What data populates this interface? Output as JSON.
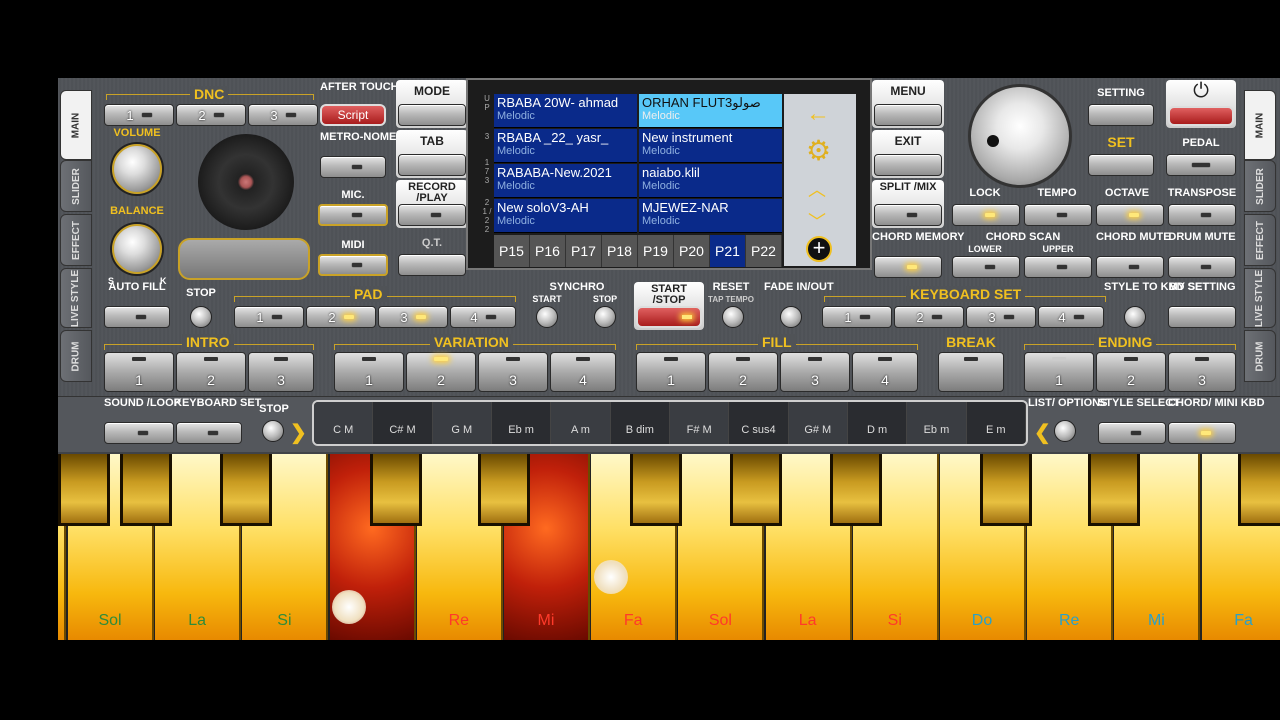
{
  "side_tabs_left": [
    "MAIN",
    "SLIDER",
    "EFFECT",
    "LIVE STYLE",
    "DRUM"
  ],
  "side_tabs_right": [
    "MAIN",
    "SLIDER",
    "EFFECT",
    "LIVE STYLE",
    "DRUM"
  ],
  "dnc": {
    "title": "DNC",
    "buttons": [
      "1",
      "2",
      "3"
    ]
  },
  "after_touch": {
    "label": "AFTER TOUCH",
    "button": "Script"
  },
  "volume": "VOLUME",
  "balance": "BALANCE",
  "balance_s": "S",
  "balance_k": "K",
  "metronome": "METRO-NOME",
  "mic": "MIC.",
  "midi": "MIDI",
  "left_col": {
    "mode": "MODE",
    "tab": "TAB",
    "record": "RECORD /PLAY",
    "qt": "Q.T."
  },
  "right_col": {
    "menu": "MENU",
    "exit": "EXIT",
    "split": "SPLIT /MIX",
    "chord_memory": "CHORD MEMORY"
  },
  "display": {
    "side_markers": [
      "U P",
      "3",
      "1 7 3",
      "2 1 / 2 2"
    ],
    "cells": [
      {
        "name": "RBABA 20W- ahmad",
        "type": "Melodic"
      },
      {
        "name": "ORHAN FLUT3صولو",
        "type": "Melodic"
      },
      {
        "name": "RBABA _22_ yasr_",
        "type": "Melodic"
      },
      {
        "name": "New instrument",
        "type": "Melodic"
      },
      {
        "name": "RABABA-New.2021",
        "type": "Melodic"
      },
      {
        "name": "naiabo.klil",
        "type": "Melodic"
      },
      {
        "name": "New soloV3-AH",
        "type": "Melodic"
      },
      {
        "name": "MJEWEZ-NAR",
        "type": "Melodic"
      }
    ],
    "pages": [
      "P15",
      "P16",
      "P17",
      "P18",
      "P19",
      "P20",
      "P21",
      "P22"
    ],
    "active_page": "P21"
  },
  "setting": "SETTING",
  "set": "SET",
  "pedal": "PEDAL",
  "lock": "LOCK",
  "tempo": "TEMPO",
  "octave": "OCTAVE",
  "transpose": "TRANSPOSE",
  "chord_scan": "CHORD SCAN",
  "chord_scan_lower": "LOWER",
  "chord_scan_upper": "UPPER",
  "chord_mute": "CHORD MUTE",
  "drum_mute": "DRUM MUTE",
  "auto_fill": "AUTO FILL",
  "stop": "STOP",
  "pad": {
    "title": "PAD",
    "buttons": [
      "1",
      "2",
      "3",
      "4"
    ]
  },
  "synchro": {
    "title": "SYNCHRO",
    "start": "START",
    "stop": "STOP"
  },
  "start_stop": "START /STOP",
  "reset": "RESET",
  "tap_tempo": "TAP TEMPO",
  "fade": "FADE IN/OUT",
  "keyboard_set": {
    "title": "KEYBOARD SET",
    "buttons": [
      "1",
      "2",
      "3",
      "4"
    ]
  },
  "style_to_kbd": "STYLE TO KBD SET",
  "my_setting": "MY SETTING",
  "intro": {
    "title": "INTRO",
    "buttons": [
      "1",
      "2",
      "3"
    ]
  },
  "variation": {
    "title": "VARIATION",
    "buttons": [
      "1",
      "2",
      "3",
      "4"
    ]
  },
  "fill": {
    "title": "FILL",
    "buttons": [
      "1",
      "2",
      "3",
      "4"
    ]
  },
  "break": "BREAK",
  "ending": {
    "title": "ENDING",
    "buttons": [
      "1",
      "2",
      "3"
    ]
  },
  "sound_loop": "SOUND /LOOP",
  "keyboard_set_label": "KEYBOARD SET",
  "stop2": "STOP",
  "chords": [
    "C M",
    "C# M",
    "G M",
    "Eb m",
    "A m",
    "B dim",
    "F# M",
    "C sus4",
    "G# M",
    "D m",
    "Eb m",
    "E m"
  ],
  "list_options": "LIST/ OPTIONS",
  "style_select": "STYLE SELECT",
  "chord_mini": "CHORD/ MINI KBD",
  "keys": [
    {
      "label": "Sol",
      "color": "#2e8b3a",
      "red": false
    },
    {
      "label": "La",
      "color": "#2e8b3a",
      "red": false
    },
    {
      "label": "Si",
      "color": "#2e8b3a",
      "red": false
    },
    {
      "label": "",
      "color": "#ff3a2a",
      "red": true
    },
    {
      "label": "Re",
      "color": "#ff3a2a",
      "red": false
    },
    {
      "label": "Mi",
      "color": "#ff3a2a",
      "red": true
    },
    {
      "label": "Fa",
      "color": "#ff3a2a",
      "red": false
    },
    {
      "label": "Sol",
      "color": "#ff3a2a",
      "red": false
    },
    {
      "label": "La",
      "color": "#ff3a2a",
      "red": false
    },
    {
      "label": "Si",
      "color": "#ff3a2a",
      "red": false
    },
    {
      "label": "Do",
      "color": "#2aa0c8",
      "red": false
    },
    {
      "label": "Re",
      "color": "#2aa0c8",
      "red": false
    },
    {
      "label": "Mi",
      "color": "#2aa0c8",
      "red": false
    },
    {
      "label": "Fa",
      "color": "#2aa0c8",
      "red": false
    }
  ]
}
